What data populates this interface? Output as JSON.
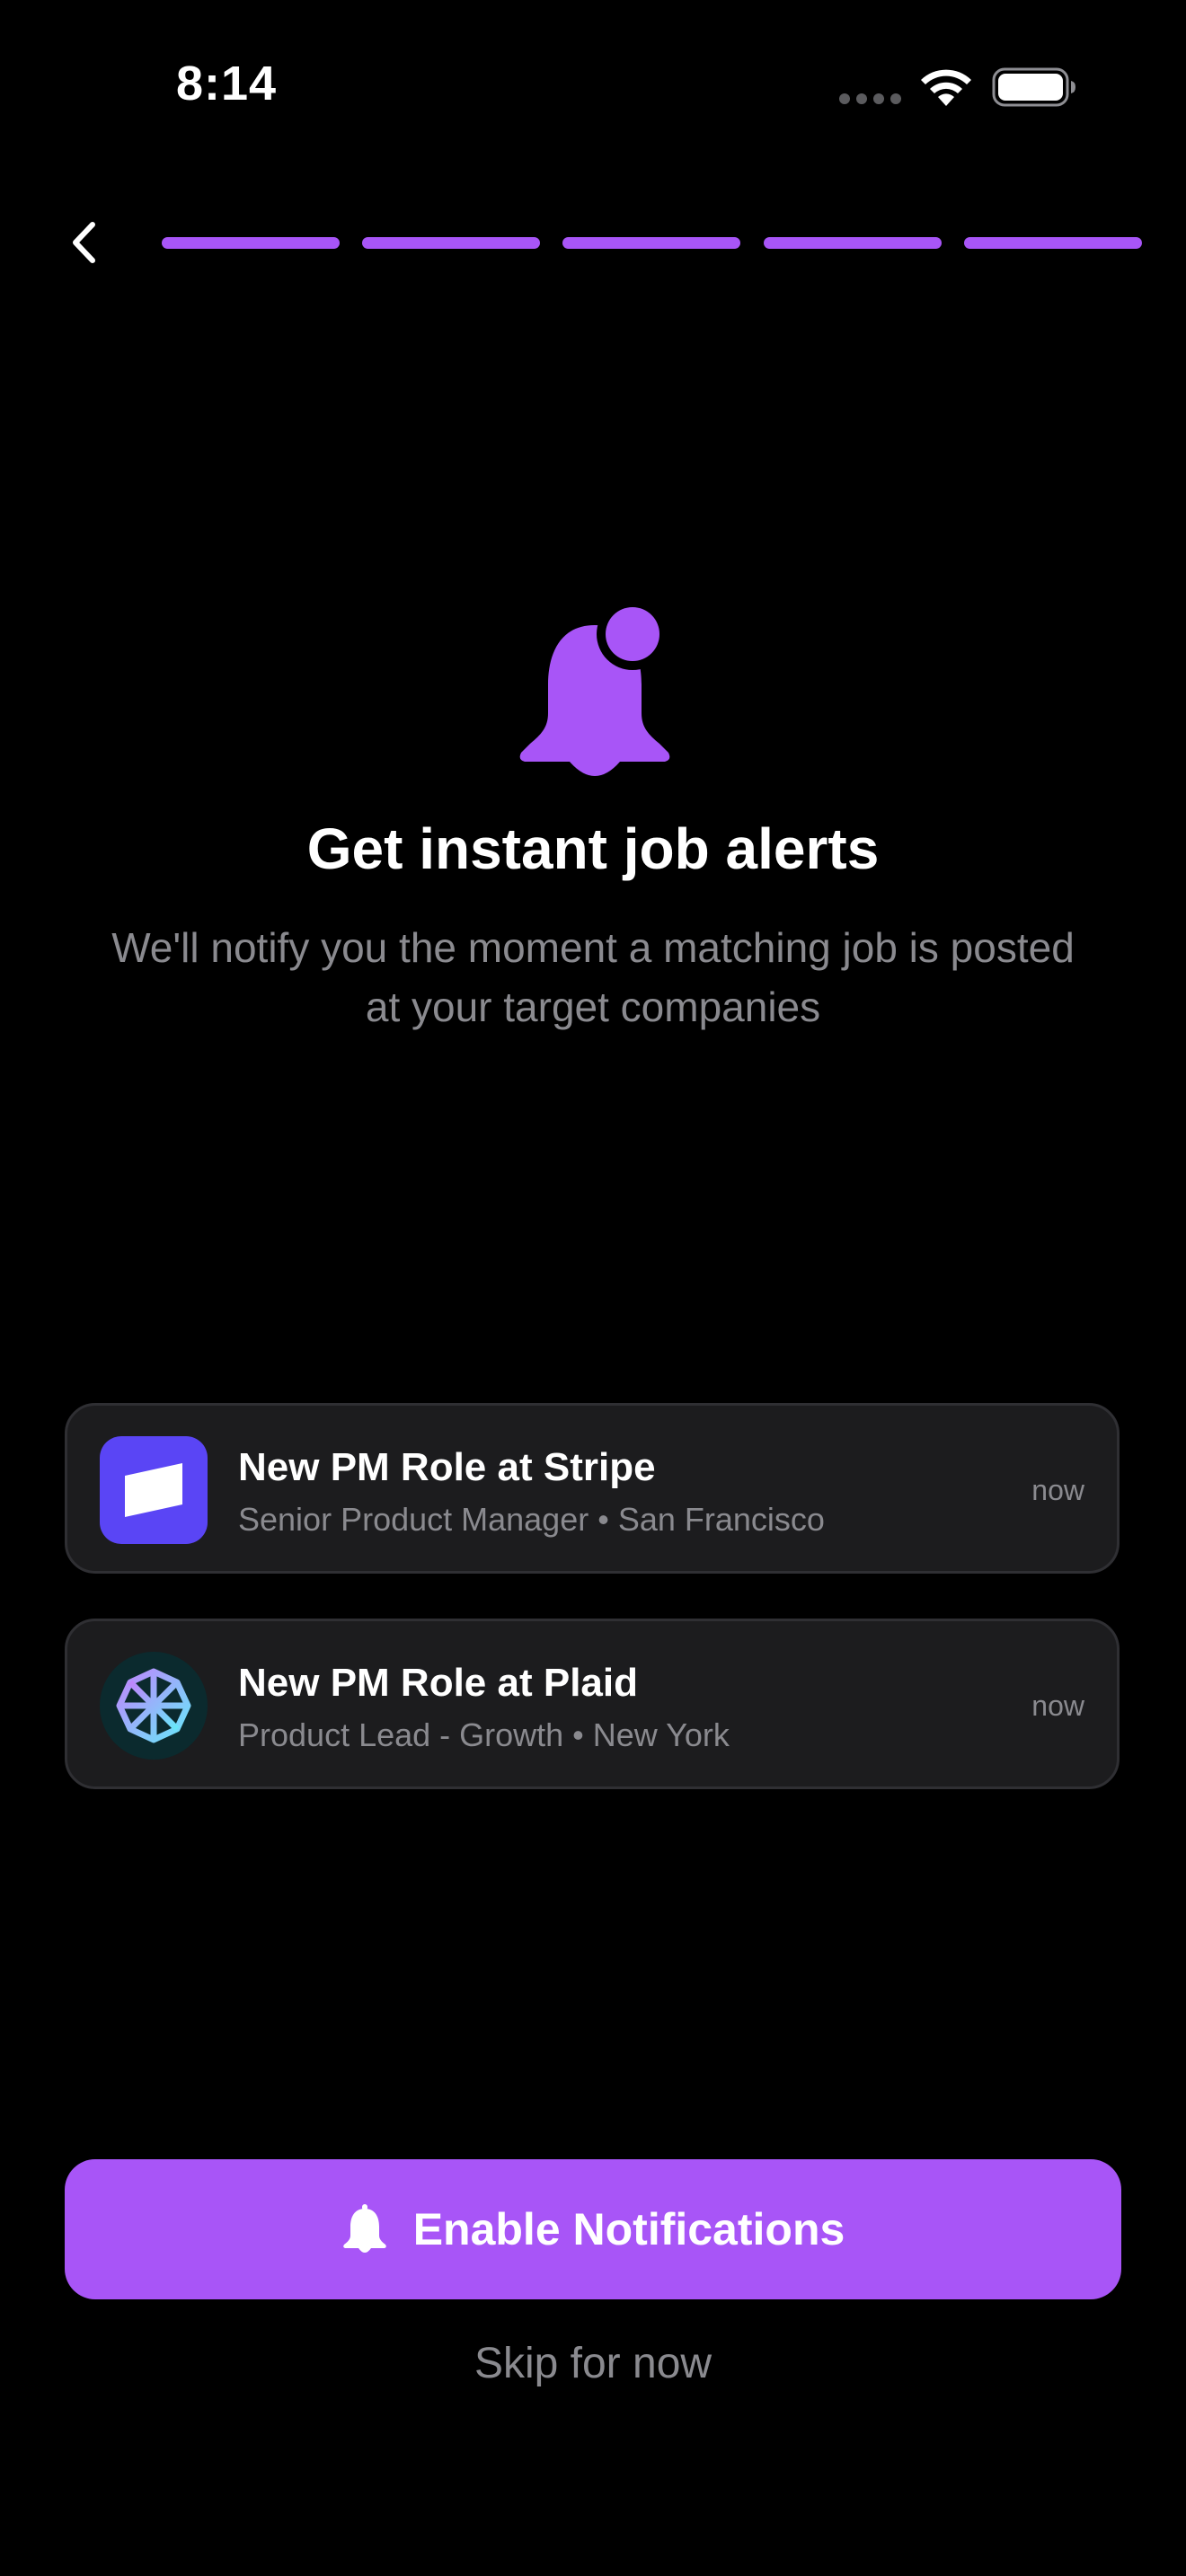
{
  "status_bar": {
    "time": "8:14"
  },
  "nav": {
    "back_icon": "chevron-left-icon",
    "progress_steps": 5,
    "progress_completed": 5
  },
  "hero": {
    "icon": "bell-badge-icon",
    "title": "Get instant job alerts",
    "subtitle": "We'll notify you the moment a matching job is posted at your target companies"
  },
  "notifications": [
    {
      "title": "New PM Role at Stripe",
      "subtitle": "Senior Product Manager • San Francisco",
      "time": "now",
      "logo": "stripe-logo-icon"
    },
    {
      "title": "New PM Role at Plaid",
      "subtitle": "Product Lead - Growth • New York",
      "time": "now",
      "logo": "plaid-logo-icon"
    }
  ],
  "cta": {
    "enable_label": "Enable Notifications",
    "skip_label": "Skip for now"
  },
  "colors": {
    "accent": "#a855f7",
    "background": "#000000",
    "card": "#1c1c1e",
    "muted_text": "#8a8a8f",
    "stripe": "#5a45f5"
  }
}
